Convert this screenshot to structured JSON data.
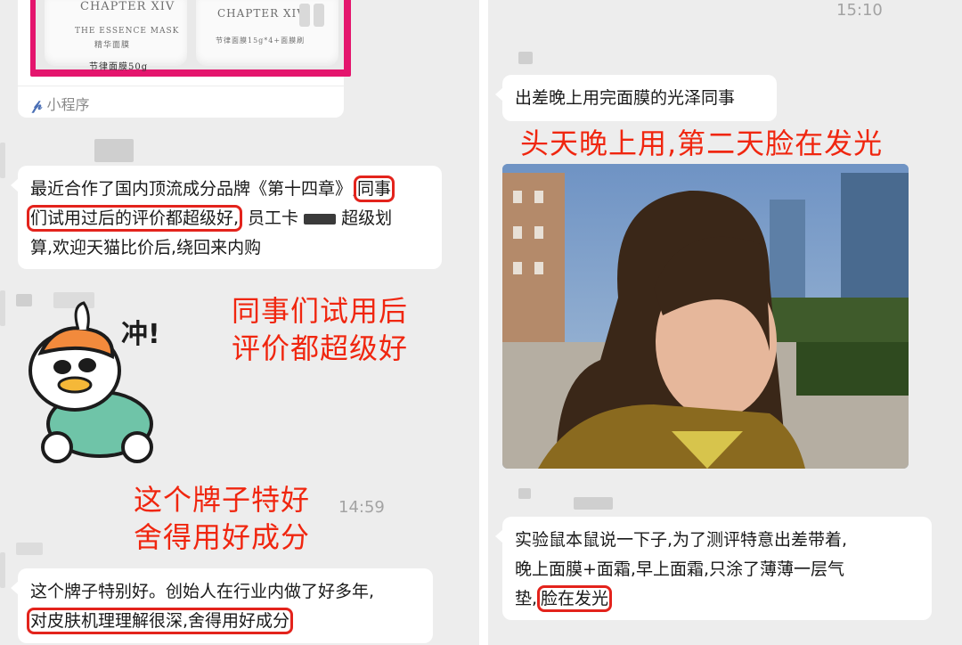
{
  "left": {
    "mini_program": {
      "product1_title": "CHAPTER XIV",
      "product1_sub": "THE ESSENCE MASK",
      "product1_cn": "精华面膜",
      "product1_bottom": "节律面膜50g",
      "product2_title": "CHAPTER XIV",
      "product2_sub": "节律面膜15g*4+面膜刷",
      "footer_label": "小程序"
    },
    "msg1": {
      "part1": "最近合作了国内顶流成分品牌《第十四章》,",
      "hl1": "同事",
      "hl2": "们试用过后的评价都超级好,",
      "part2": "员工卡",
      "part3": "超级划",
      "part4": "算,欢迎天猫比价后,绕回来内购"
    },
    "sticker_text": "冲!",
    "anno1_line1": "同事们试用后",
    "anno1_line2": "评价都超级好",
    "anno2_line1": "这个牌子特好",
    "anno2_line2": "舍得用好成分",
    "time": "14:59",
    "msg2": {
      "line1": "这个牌子特别好。创始人在行业内做了好多年,",
      "hl": "对皮肤机理理解很深,舍得用好成分"
    }
  },
  "right": {
    "time": "15:10",
    "msg1": "出差晚上用完面膜的光泽同事",
    "anno": "头天晚上用,第二天脸在发光",
    "msg2": {
      "line1": "实验鼠本鼠说一下子,为了测评特意出差带着,",
      "line2": "晚上面膜+面霜,早上面霜,只涂了薄薄一层气",
      "line3a": "垫,",
      "hl": "脸在发光"
    }
  },
  "colors": {
    "annotation_red": "#f0260f",
    "highlight_red": "#e3231c",
    "chat_bg": "#ededed",
    "bubble": "#ffffff",
    "mini_program_pink": "#e4156d"
  }
}
